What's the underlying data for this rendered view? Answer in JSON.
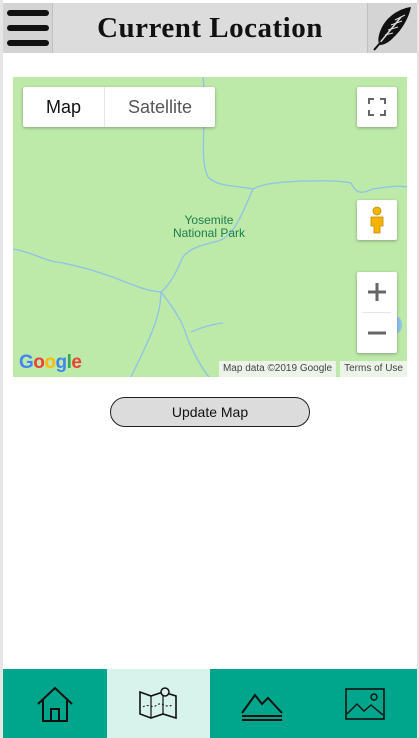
{
  "header": {
    "title": "Current Location",
    "menu_icon": "hamburger-menu-icon",
    "right_icon": "feather-icon"
  },
  "map": {
    "type_control": {
      "map_label": "Map",
      "satellite_label": "Satellite",
      "selected": "Map"
    },
    "place_label": "Yosemite National Park",
    "logo_text": "Google",
    "attribution": "Map data ©2019 Google",
    "terms_label": "Terms of Use",
    "controls": [
      "fullscreen-icon",
      "pegman-icon",
      "zoom-in-icon",
      "zoom-out-icon"
    ],
    "colors": {
      "land": "#bde9a9",
      "river": "#8ec2e8",
      "label": "#1e7e4a"
    }
  },
  "update_button": {
    "label": "Update Map"
  },
  "bottom_nav": {
    "items": [
      {
        "name": "home",
        "icon": "home-icon",
        "active": false
      },
      {
        "name": "map",
        "icon": "map-pin-icon",
        "active": true
      },
      {
        "name": "mountains",
        "icon": "mountain-icon",
        "active": false
      },
      {
        "name": "photos",
        "icon": "image-icon",
        "active": false
      }
    ],
    "colors": {
      "background": "#00a68c",
      "active": "#d8f2ec"
    }
  }
}
